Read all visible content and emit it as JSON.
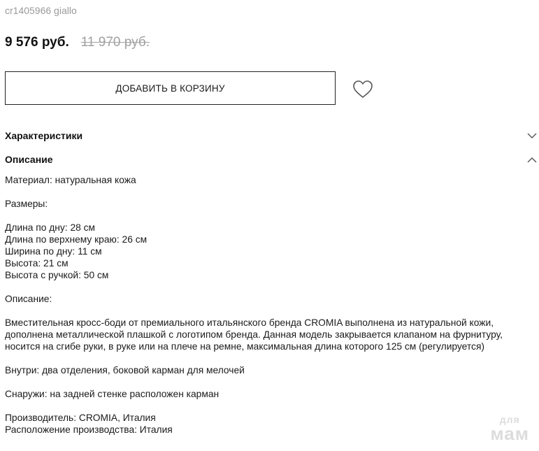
{
  "product": {
    "sku": "cr1405966 giallo",
    "price": "9 576 руб.",
    "old_price": "11 970 руб.",
    "add_to_cart_label": "ДОБАВИТЬ В КОРЗИНУ"
  },
  "sections": {
    "characteristics": {
      "title": "Характеристики",
      "state": "collapsed"
    },
    "description": {
      "title": "Описание",
      "state": "expanded"
    }
  },
  "description": {
    "material": "Материал: натуральная кожа",
    "sizes_title": "Размеры:",
    "sizes": [
      "Длина по дну: 28 см",
      "Длина по верхнему краю: 26 см",
      "Ширина по дну: 11 см",
      "Высота: 21 см",
      "Высота с ручкой: 50 см"
    ],
    "desc_title": "Описание:",
    "desc_text": "Вместительная кросс-боди от премиального итальянского бренда CROMIA выполнена из натуральной кожи, дополнена металлической плашкой с логотипом бренда. Данная модель закрывается клапаном на фурнитуру, носится на сгибе руки, в руке или на плече на ремне, максимальная длина которого 125 см (регулируется)",
    "inside": "Внутри: два отделения, боковой карман для мелочей",
    "outside": "Снаружи: на задней стенке расположен карман",
    "manufacturer": "Производитель: CROMIA, Италия",
    "production_location": "Расположение производства: Италия"
  },
  "watermark": {
    "small": "для",
    "big": "мам"
  },
  "icons": {
    "favorite": "heart-icon",
    "collapsed": "chevron-down-icon",
    "expanded": "chevron-up-icon"
  }
}
